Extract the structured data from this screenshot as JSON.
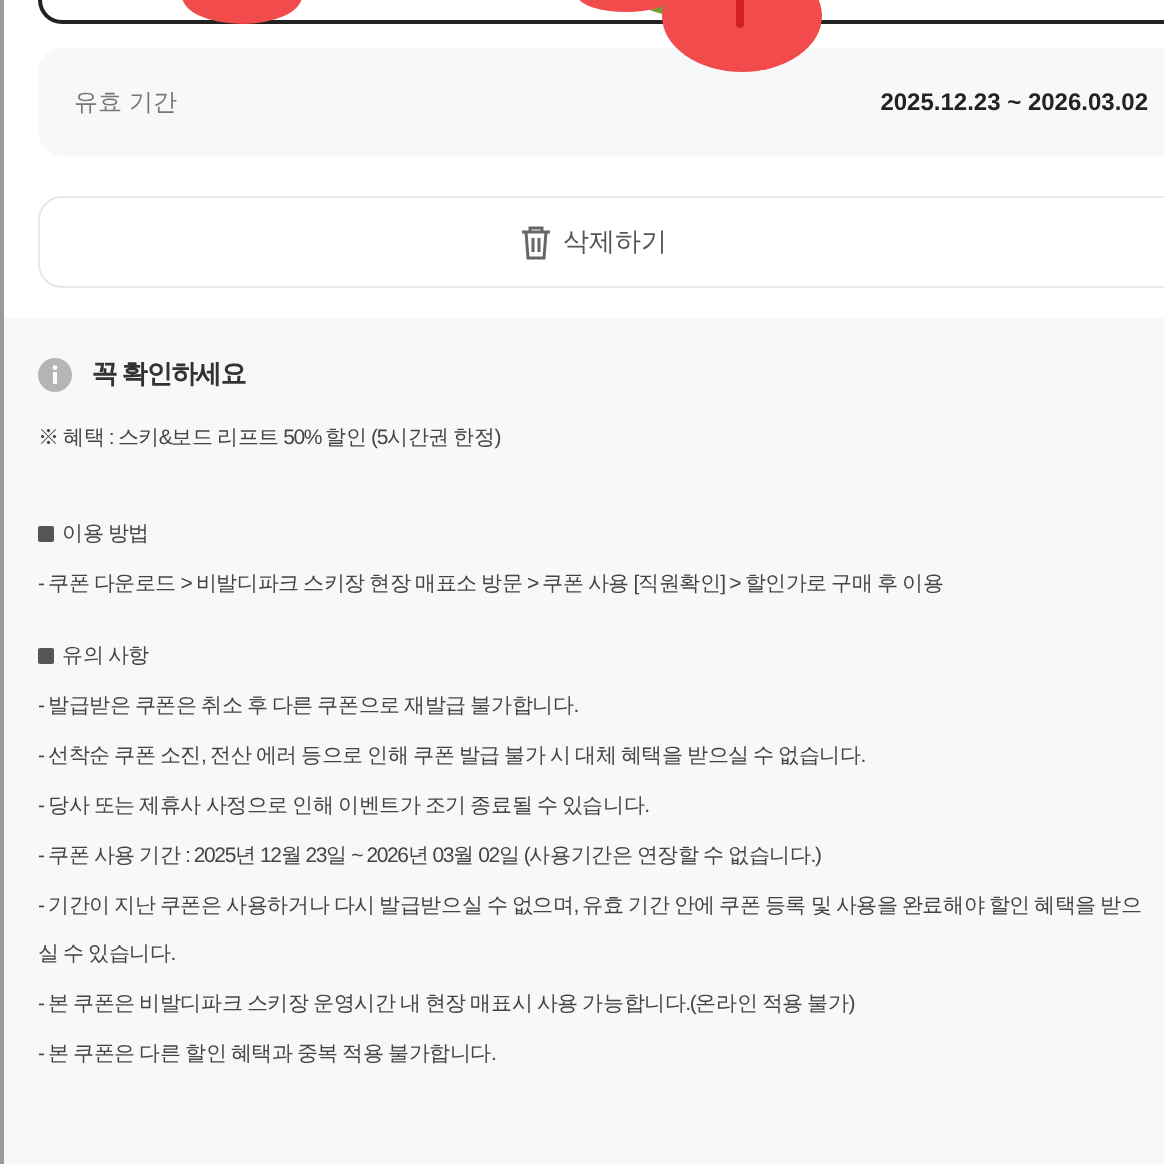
{
  "validity": {
    "label": "유효 기간",
    "value": "2025.12.23 ~ 2026.03.02"
  },
  "delete_button": {
    "label": "삭제하기"
  },
  "notice": {
    "title": "꼭 확인하세요",
    "benefit": "※ 혜택 : 스키&보드 리프트 50% 할인 (5시간권 한정)",
    "sections": [
      {
        "heading": "이용 방법",
        "lines": [
          "- 쿠폰 다운로드 > 비발디파크 스키장 현장 매표소 방문 > 쿠폰 사용 [직원확인] > 할인가로 구매 후 이용"
        ]
      },
      {
        "heading": "유의 사항",
        "lines": [
          "- 발급받은 쿠폰은 취소 후 다른 쿠폰으로 재발급 불가합니다.",
          "- 선착순 쿠폰 소진, 전산 에러 등으로 인해 쿠폰 발급 불가 시 대체 혜택을 받으실 수 없습니다.",
          "- 당사 또는 제휴사 사정으로 인해 이벤트가 조기 종료될 수 있습니다.",
          "- 쿠폰 사용 기간 : 2025년 12월 23일 ~ 2026년 03월 02일 (사용기간은 연장할 수 없습니다.)",
          "- 기간이 지난 쿠폰은 사용하거나 다시 발급받으실 수 없으며, 유효 기간 안에 쿠폰 등록 및 사용을 완료해야 할인 혜택을 받으\n실 수 있습니다.",
          "- 본 쿠폰은 비발디파크 스키장 운영시간 내 현장 매표시 사용 가능합니다.(온라인 적용 불가)",
          "- 본 쿠폰은 다른 할인 혜택과 중복 적용 불가합니다."
        ]
      }
    ]
  }
}
